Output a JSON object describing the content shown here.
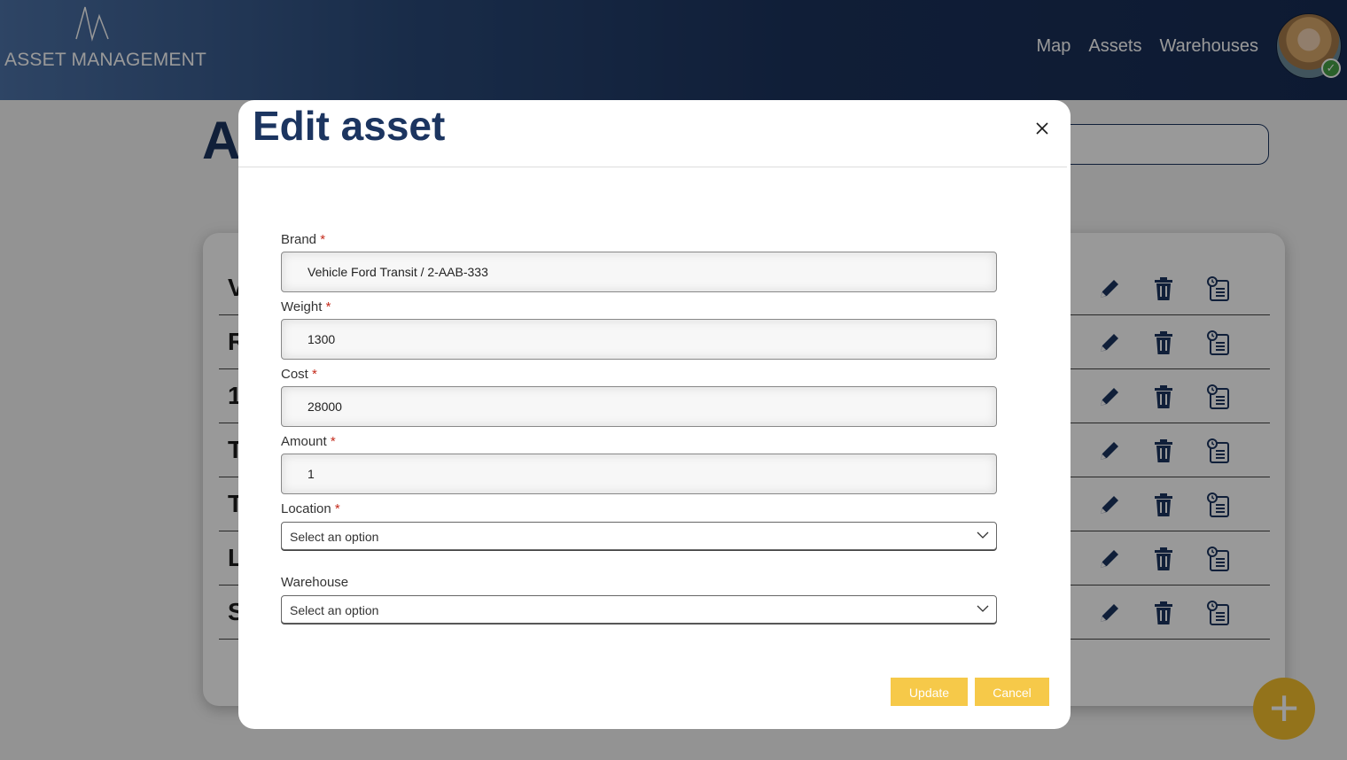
{
  "app": {
    "logo_text": "ASSET MANAGEMENT",
    "nav": [
      "Map",
      "Assets",
      "Warehouses"
    ]
  },
  "page": {
    "title_partial": "A",
    "rows": [
      "V",
      "R",
      "1",
      "T",
      "T",
      "L",
      "S"
    ]
  },
  "modal": {
    "title": "Edit asset",
    "required_marker": "*",
    "fields": {
      "brand": {
        "label": "Brand",
        "value": "Vehicle Ford Transit / 2-AAB-333"
      },
      "weight": {
        "label": "Weight",
        "value": "1300"
      },
      "cost": {
        "label": "Cost",
        "value": "28000"
      },
      "amount": {
        "label": "Amount",
        "value": "1"
      },
      "location": {
        "label": "Location",
        "placeholder": "Select an option"
      },
      "warehouse": {
        "label": "Warehouse",
        "placeholder": "Select an option"
      }
    },
    "buttons": {
      "update": "Update",
      "cancel": "Cancel"
    }
  },
  "colors": {
    "brand_navy": "#1c3560",
    "accent_yellow": "#f6c949",
    "required_red": "#c42b1c",
    "status_green": "#46a046"
  },
  "icons": {
    "row_actions": [
      "pencil-icon",
      "trash-icon",
      "history-clipboard-icon"
    ],
    "close": "close-icon",
    "fab": "plus-icon"
  }
}
